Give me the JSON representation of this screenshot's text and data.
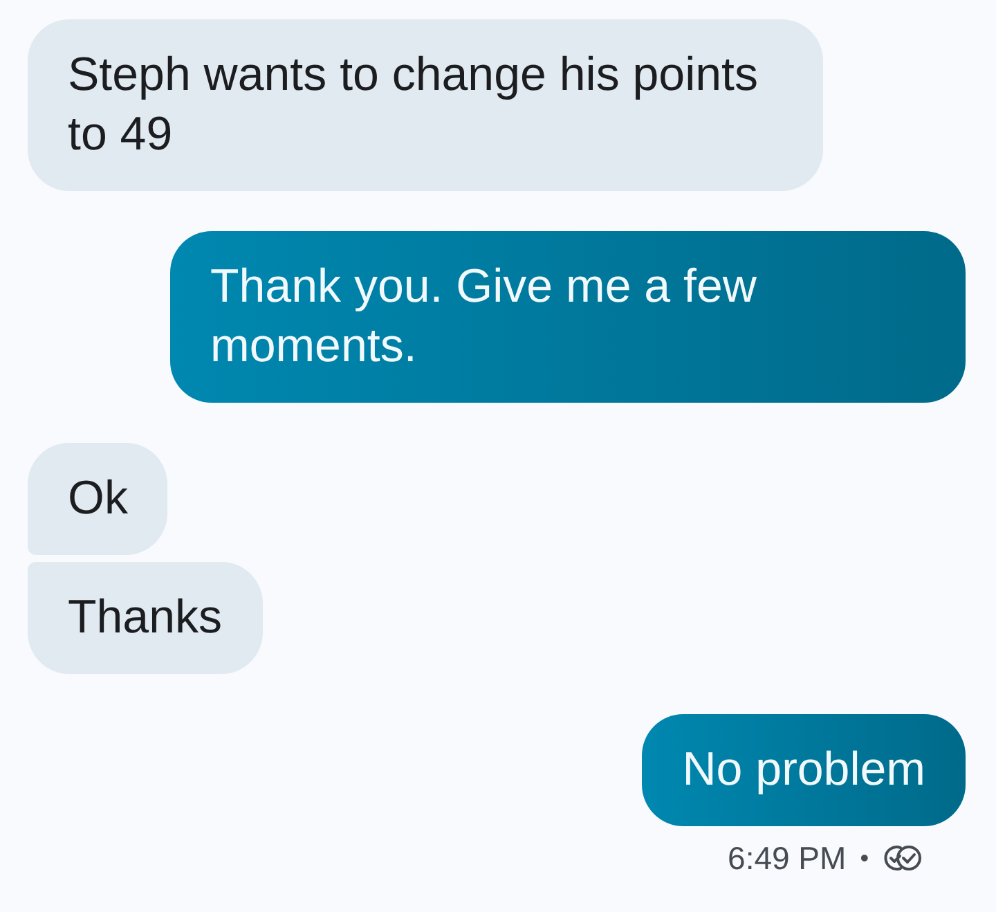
{
  "messages": [
    {
      "kind": "incoming",
      "text": "Steph wants to change his points to 49"
    },
    {
      "kind": "outgoing",
      "text": "Thank you. Give me a few moments."
    },
    {
      "kind": "incoming",
      "text": "Ok"
    },
    {
      "kind": "incoming",
      "text": "Thanks"
    },
    {
      "kind": "outgoing",
      "text": "No problem"
    }
  ],
  "status": {
    "time": "6:49 PM",
    "separator": "•",
    "read": true
  }
}
